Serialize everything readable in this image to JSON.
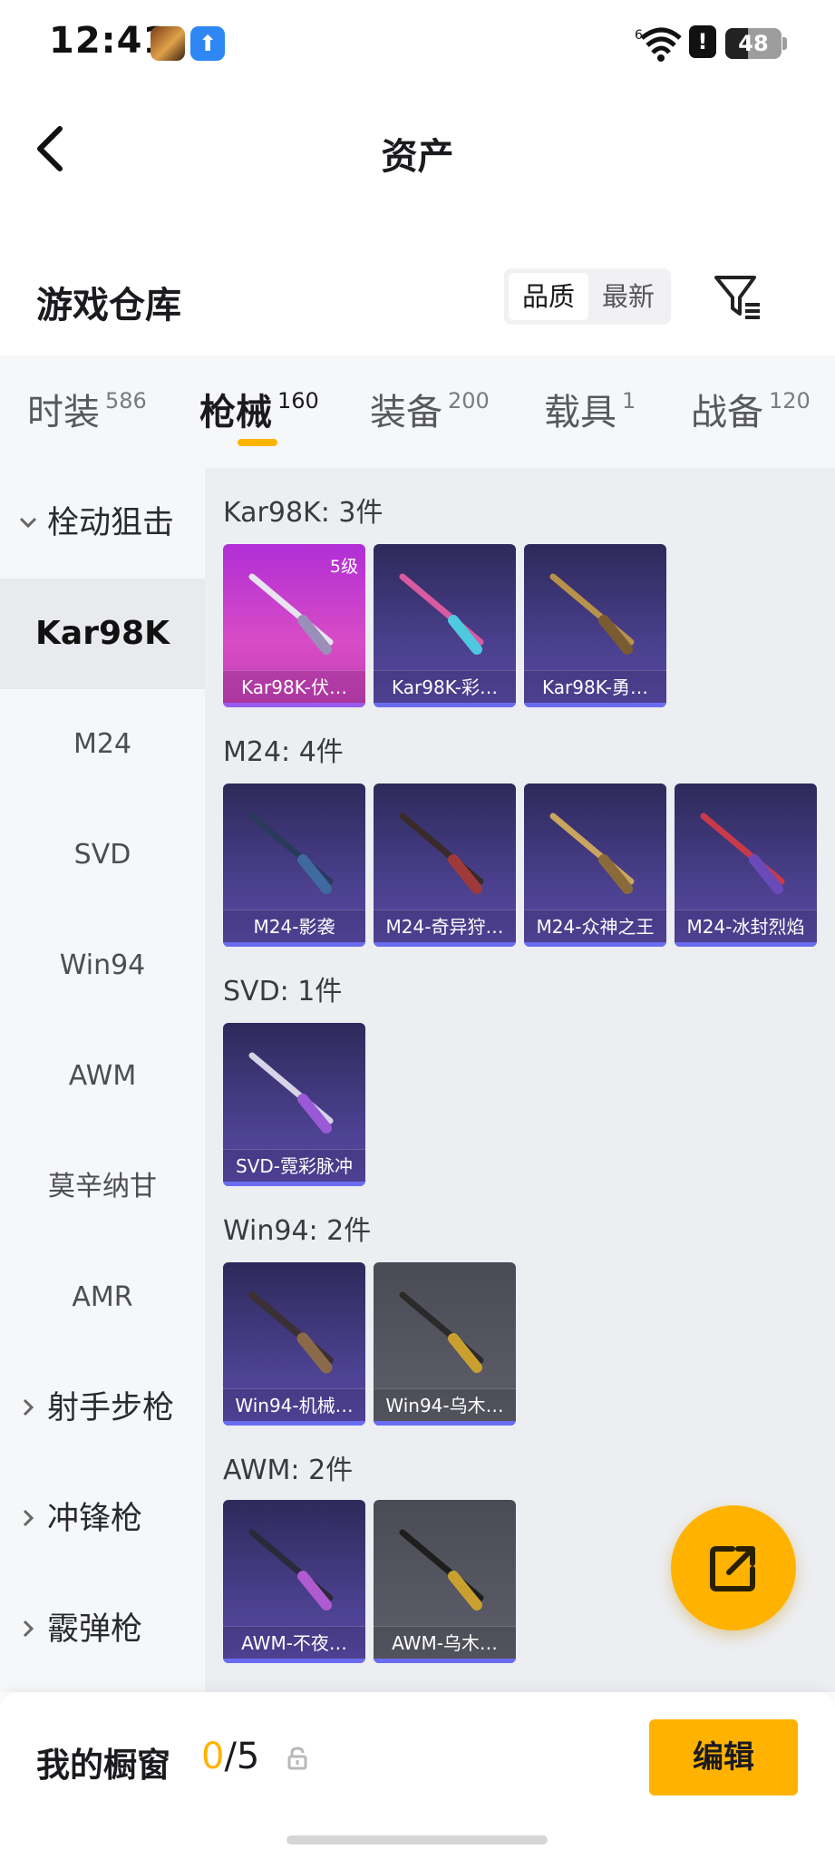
{
  "status_bar": {
    "time": "12:41",
    "battery": "48",
    "alert": "!"
  },
  "header": {
    "title": "资产",
    "back_icon": "chevron-left-icon"
  },
  "warehouse": {
    "title": "游戏仓库",
    "sort_options": [
      "品质",
      "最新"
    ],
    "selected_sort": "品质",
    "filter_icon": "filter-icon"
  },
  "tabs": [
    {
      "label": "时装",
      "count": "586"
    },
    {
      "label": "枪械",
      "count": "160",
      "active": true
    },
    {
      "label": "装备",
      "count": "200"
    },
    {
      "label": "载具",
      "count": "1"
    },
    {
      "label": "战备",
      "count": "120"
    }
  ],
  "sidebar": {
    "groups": [
      {
        "label": "栓动狙击",
        "expanded": true
      },
      {
        "label": "射手步枪",
        "expanded": false
      },
      {
        "label": "冲锋枪",
        "expanded": false
      },
      {
        "label": "霰弹枪",
        "expanded": false
      }
    ],
    "items": [
      "Kar98K",
      "M24",
      "SVD",
      "Win94",
      "AWM",
      "莫辛纳甘",
      "AMR"
    ],
    "active_item": "Kar98K"
  },
  "groups": [
    {
      "label": "Kar98K: 3件",
      "items": [
        {
          "name": "Kar98K-伏…",
          "level": "5级",
          "tier": "pink"
        },
        {
          "name": "Kar98K-彩…",
          "tier": "purple"
        },
        {
          "name": "Kar98K-勇…",
          "tier": "purple"
        }
      ]
    },
    {
      "label": "M24: 4件",
      "items": [
        {
          "name": "M24-影袭",
          "tier": "purple"
        },
        {
          "name": "M24-奇异狩…",
          "tier": "purple"
        },
        {
          "name": "M24-众神之王",
          "tier": "purple"
        },
        {
          "name": "M24-冰封烈焰",
          "tier": "purple"
        }
      ]
    },
    {
      "label": "SVD: 1件",
      "items": [
        {
          "name": "SVD-霓彩脉冲",
          "tier": "purple"
        }
      ]
    },
    {
      "label": "Win94: 2件",
      "items": [
        {
          "name": "Win94-机械…",
          "tier": "purple"
        },
        {
          "name": "Win94-乌木…",
          "tier": "gray"
        }
      ]
    },
    {
      "label": "AWM: 2件",
      "items": [
        {
          "name": "AWM-不夜…",
          "tier": "purple"
        },
        {
          "name": "AWM-乌木…",
          "tier": "gray"
        }
      ]
    }
  ],
  "showcase": {
    "title": "我的橱窗",
    "current": "0",
    "total": "/5",
    "edit_label": "编辑"
  },
  "colors": {
    "accent": "#ffb300",
    "pink_tier": "#c13db4",
    "purple_tier": "#4a3f8c",
    "gray_tier": "#5e5f6a"
  }
}
